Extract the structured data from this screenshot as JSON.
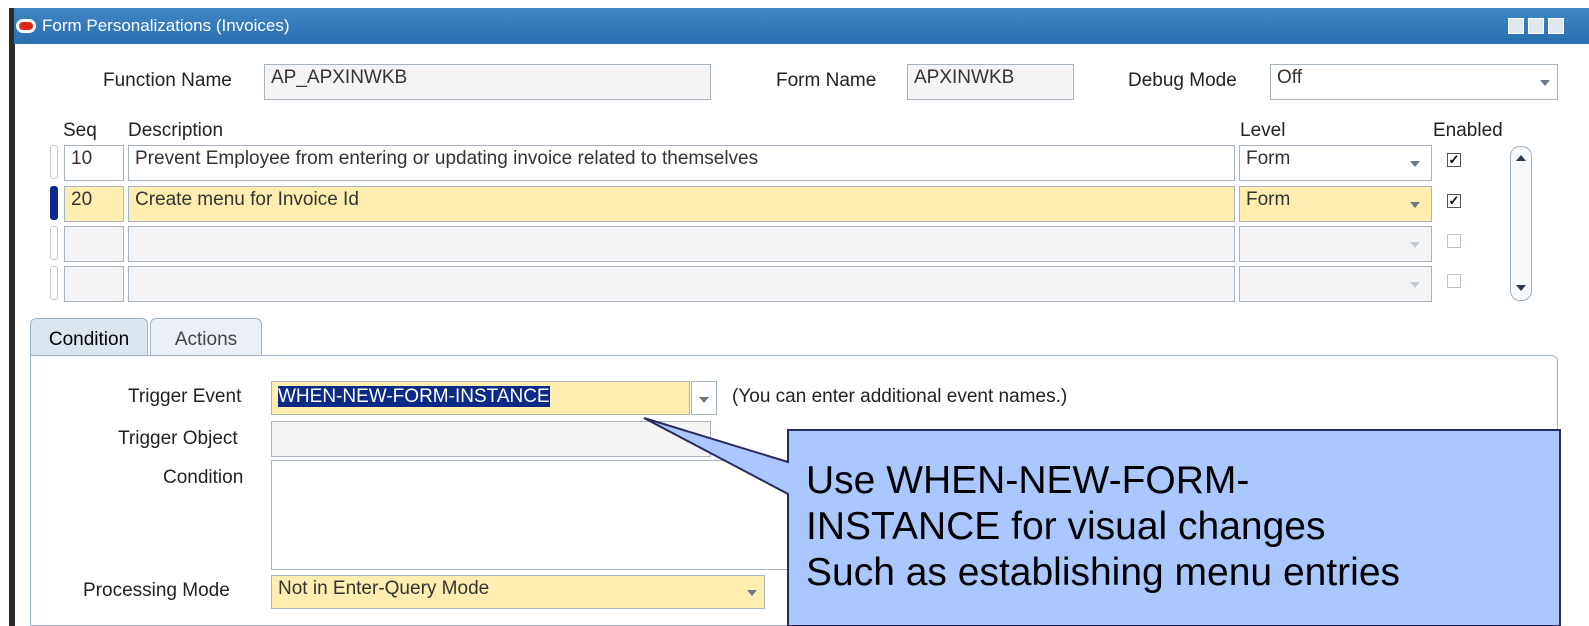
{
  "window": {
    "title": "Form Personalizations (Invoices)"
  },
  "header": {
    "function_name_label": "Function Name",
    "function_name_value": "AP_APXINWKB",
    "form_name_label": "Form Name",
    "form_name_value": "APXINWKB",
    "debug_mode_label": "Debug Mode",
    "debug_mode_value": "Off"
  },
  "grid": {
    "columns": {
      "seq": "Seq",
      "description": "Description",
      "level": "Level",
      "enabled": "Enabled"
    },
    "rows": [
      {
        "seq": "10",
        "description": "Prevent Employee from entering or updating invoice related to themselves",
        "level": "Form",
        "enabled": true,
        "current": false
      },
      {
        "seq": "20",
        "description": "Create menu for Invoice Id",
        "level": "Form",
        "enabled": true,
        "current": true
      },
      {
        "seq": "",
        "description": "",
        "level": "",
        "enabled": false,
        "current": false
      },
      {
        "seq": "",
        "description": "",
        "level": "",
        "enabled": false,
        "current": false
      }
    ]
  },
  "tabs": [
    {
      "label": "Condition",
      "active": true
    },
    {
      "label": "Actions",
      "active": false
    }
  ],
  "condition": {
    "trigger_event_label": "Trigger Event",
    "trigger_event_value": "WHEN-NEW-FORM-INSTANCE",
    "trigger_event_hint": "(You can enter additional event names.)",
    "trigger_object_label": "Trigger Object",
    "trigger_object_value": "",
    "condition_label": "Condition",
    "condition_value": "",
    "processing_mode_label": "Processing Mode",
    "processing_mode_value": "Not in Enter-Query Mode"
  },
  "callout": {
    "lines": [
      "Use WHEN-NEW-FORM-",
      "INSTANCE for visual changes",
      "Such as establishing menu entries"
    ],
    "fill_color": "#aac8ff"
  },
  "colors": {
    "titlebar": "#2f78ba",
    "field_yellow": "#ffeeb0",
    "current_row_marker": "#0b2b8c"
  }
}
